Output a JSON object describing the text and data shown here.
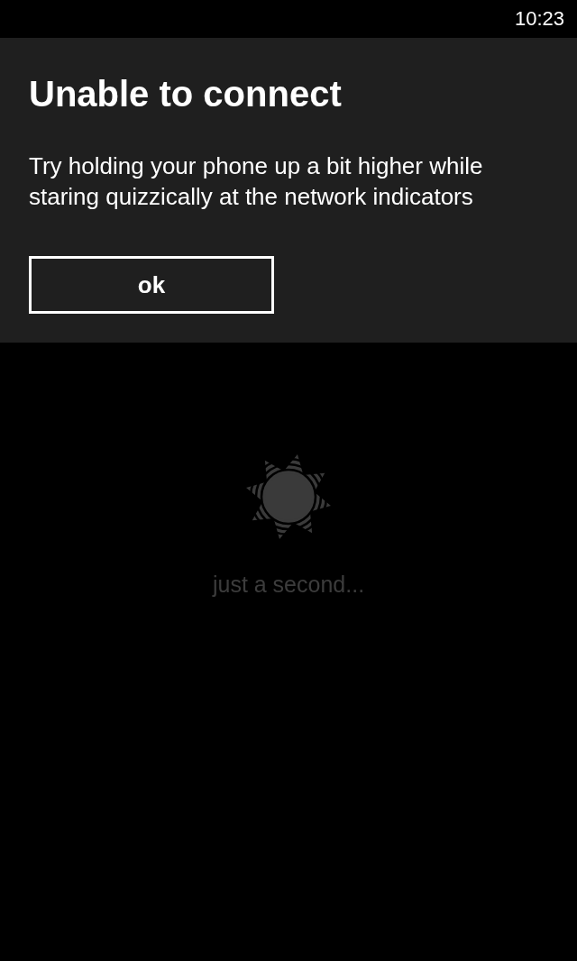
{
  "status_bar": {
    "time": "10:23"
  },
  "dialog": {
    "title": "Unable to connect",
    "message": "Try holding your phone up a bit higher while staring quizzically at the network indicators",
    "buttons": [
      {
        "label": "ok"
      }
    ]
  },
  "loading": {
    "text": "just a second..."
  }
}
